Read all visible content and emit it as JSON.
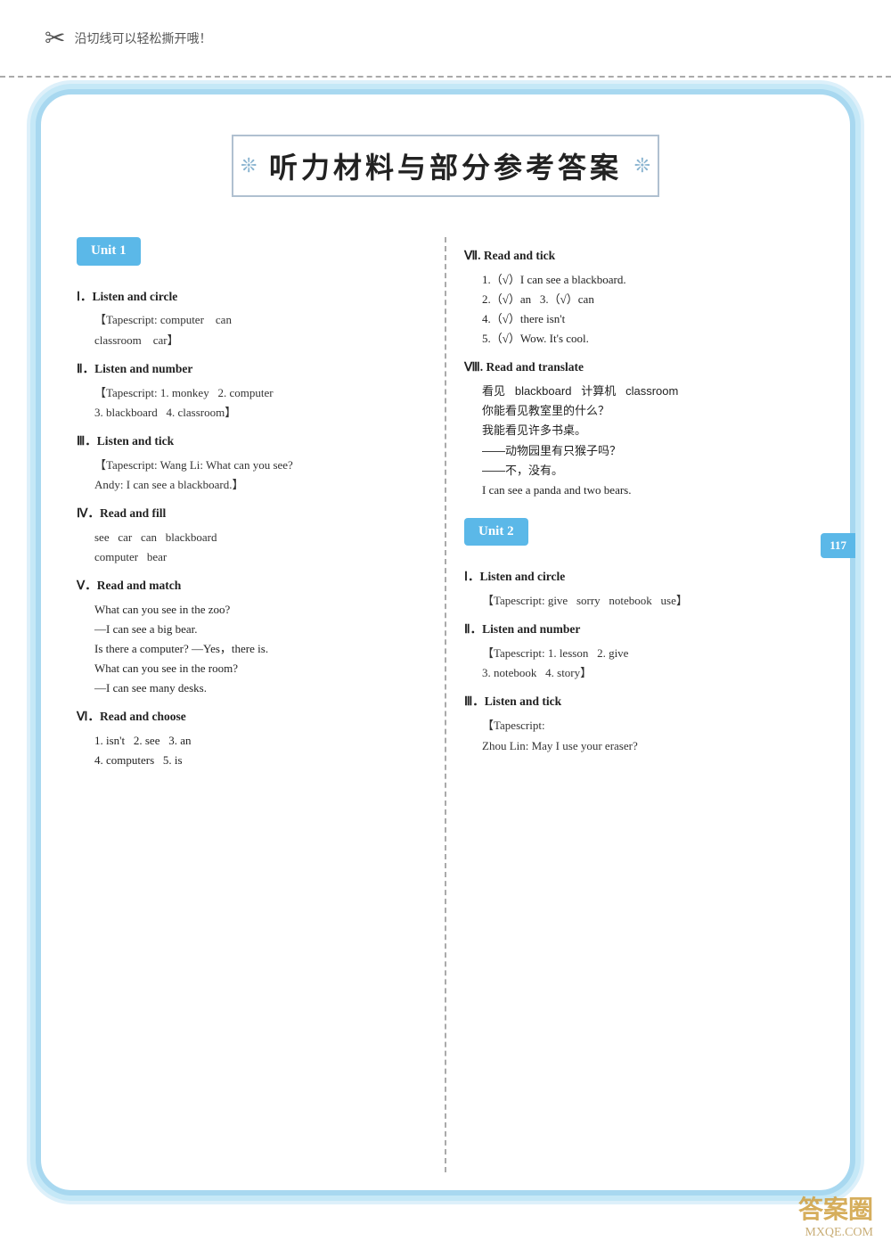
{
  "topStrip": {
    "scissors": "✂",
    "cutText": "沿切线可以轻松撕开哦！"
  },
  "title": {
    "text": "听力材料与部分参考答案",
    "decoLeft": "❊",
    "decoRight": "❊"
  },
  "left": {
    "unit1": {
      "badge": "Unit 1",
      "sections": [
        {
          "label": "Ⅰ．Listen and circle",
          "tapescript": "【Tapescript: computer    can",
          "tapescript2": "classroom    car】"
        },
        {
          "label": "Ⅱ．Listen and number",
          "tapescript": "【Tapescript: 1. monkey    2. computer",
          "tapescript2": "3. blackboard    4. classroom】"
        },
        {
          "label": "Ⅲ．Listen and tick",
          "tapescript": "【Tapescript: Wang Li: What can you see?",
          "tapescript2": "Andy: I can see a blackboard.】"
        },
        {
          "label": "Ⅳ．Read and fill",
          "tapescript": "see    car    can    blackboard",
          "tapescript2": "computer    bear"
        },
        {
          "label": "Ⅴ．Read and match",
          "items": [
            "What can you see in the zoo?",
            "—I can see a big bear.",
            "Is there a computer?  —Yes，there is.",
            "What can you see in the room?",
            "—I can see many desks."
          ]
        },
        {
          "label": "Ⅵ．Read and choose",
          "line1": "1. isn't    2. see    3. an",
          "line2": "4. computers    5. is"
        }
      ]
    }
  },
  "right": {
    "unit1sections": [
      {
        "label": "Ⅶ. Read and tick",
        "items": [
          "1.（√）I can see a blackboard.",
          "2.（√）an    3.（√）can",
          "4.（√）there isn't",
          "5.（√）Wow. It's cool."
        ]
      },
      {
        "label": "Ⅷ. Read and translate",
        "items": [
          "看见    blackboard    计算机    classroom",
          "你能看见教室里的什么？",
          "我能看见许多书桌。",
          "——动物园里有只猴子吗？",
          "——不，没有。",
          "I can see a panda and two bears."
        ]
      }
    ],
    "unit2": {
      "badge": "Unit 2",
      "sections": [
        {
          "label": "Ⅰ．Listen and circle",
          "tapescript": "【Tapescript: give    sorry    notebook    use】"
        },
        {
          "label": "Ⅱ．Listen and number",
          "tapescript": "【Tapescript: 1. lesson    2. give",
          "tapescript2": "3. notebook    4. story】"
        },
        {
          "label": "Ⅲ．Listen and tick",
          "tapescript": "【Tapescript:",
          "tapescript2": "Zhou Lin: May I use your eraser?"
        }
      ]
    }
  },
  "pageNum": "117",
  "watermark": {
    "text1": "答案圈",
    "text2": "MXQE.COM"
  }
}
